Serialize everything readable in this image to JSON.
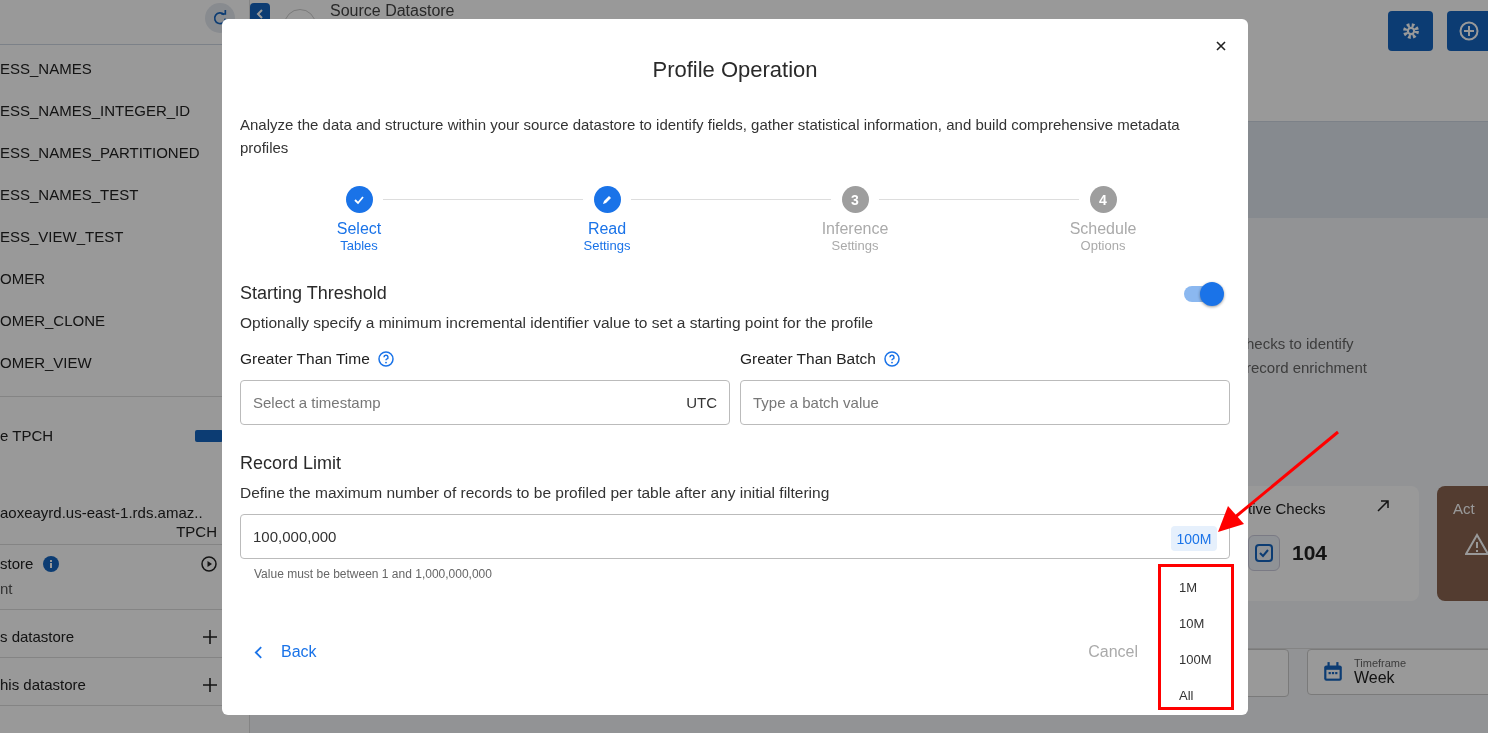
{
  "sidebar": {
    "items": [
      "ESS_NAMES",
      "ESS_NAMES_INTEGER_ID",
      "ESS_NAMES_PARTITIONED",
      "ESS_NAMES_TEST",
      "ESS_VIEW_TEST",
      "OMER",
      "OMER_CLONE",
      "OMER_VIEW"
    ],
    "datastore": {
      "name": "e TPCH",
      "host": "aoxeayrd.us-east-1.rds.amaz..",
      "database": "TPCH"
    },
    "sections": [
      {
        "kind": "play",
        "title": "store",
        "subtitle": "nt"
      },
      {
        "kind": "add",
        "title": "s datastore"
      },
      {
        "kind": "add",
        "title": "his datastore"
      }
    ]
  },
  "header": {
    "title": "Source Datastore"
  },
  "background": {
    "description_lines": [
      "hecks to identify",
      "record enrichment"
    ],
    "cards": [
      {
        "kind": "checks",
        "title": "tive Checks",
        "value": "104"
      },
      {
        "kind": "alerts",
        "title": "Act"
      }
    ],
    "filter": {
      "label": "Timeframe",
      "value": "Week"
    }
  },
  "dialog": {
    "title": "Profile Operation",
    "description": "Analyze the data and structure within your source datastore to identify fields, gather statistical information, and build comprehensive metadata profiles",
    "steps": [
      {
        "kind": "done",
        "title": "Select",
        "subtitle": "Tables"
      },
      {
        "kind": "edit",
        "title": "Read",
        "subtitle": "Settings"
      },
      {
        "kind": "pending",
        "number": "3",
        "title": "Inference",
        "subtitle": "Settings"
      },
      {
        "kind": "pending",
        "number": "4",
        "title": "Schedule",
        "subtitle": "Options"
      }
    ],
    "threshold": {
      "title": "Starting Threshold",
      "description": "Optionally specify a minimum incremental identifier value to set a starting point for the profile",
      "on": true
    },
    "fields": [
      {
        "label": "Greater Than Time",
        "placeholder": "Select a timestamp",
        "suffix": "UTC"
      },
      {
        "label": "Greater Than Batch",
        "placeholder": "Type a batch value"
      }
    ],
    "record_limit": {
      "title": "Record Limit",
      "description": "Define the maximum number of records to be profiled per table after any initial filtering",
      "value": "100,000,000",
      "chip": "100M",
      "help": "Value must be between 1 and 1,000,000,000"
    },
    "options": [
      "1M",
      "10M",
      "100M",
      "All"
    ],
    "back": "Back",
    "cancel": "Cancel"
  }
}
